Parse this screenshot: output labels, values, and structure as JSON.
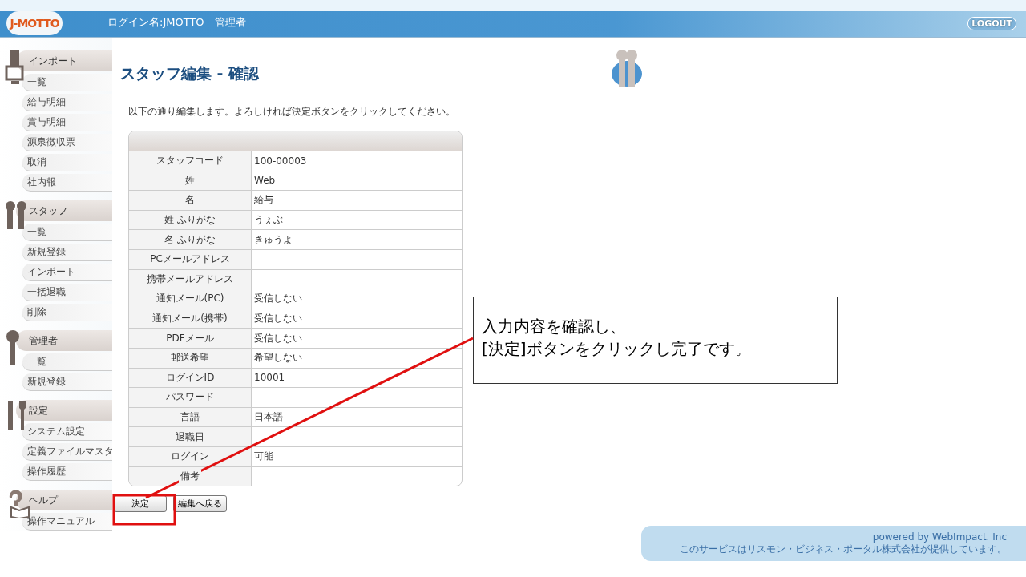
{
  "header": {
    "logo": "J-MOTTO",
    "login_label": "ログイン名:JMOTTO　管理者",
    "logout": "LOGOUT"
  },
  "sidebar": {
    "groups": [
      {
        "title": "インポート",
        "items": [
          "一覧",
          "給与明細",
          "賞与明細",
          "源泉徴収票",
          "取消",
          "社内報"
        ]
      },
      {
        "title": "スタッフ",
        "items": [
          "一覧",
          "新規登録",
          "インポート",
          "一括退職",
          "削除"
        ]
      },
      {
        "title": "管理者",
        "items": [
          "一覧",
          "新規登録"
        ]
      },
      {
        "title": "設定",
        "items": [
          "システム設定",
          "定義ファイルマスタ",
          "操作履歴"
        ]
      },
      {
        "title": "ヘルプ",
        "items": [
          "操作マニュアル"
        ]
      }
    ]
  },
  "page": {
    "title": "スタッフ編集 - 確認",
    "instruction": "以下の通り編集します。よろしければ決定ボタンをクリックしてください。"
  },
  "table": {
    "rows": [
      {
        "label": "スタッフコード",
        "value": "100-00003"
      },
      {
        "label": "姓",
        "value": "Web"
      },
      {
        "label": "名",
        "value": "給与"
      },
      {
        "label": "姓 ふりがな",
        "value": "うぇぶ"
      },
      {
        "label": "名 ふりがな",
        "value": "きゅうよ"
      },
      {
        "label": "PCメールアドレス",
        "value": ""
      },
      {
        "label": "携帯メールアドレス",
        "value": ""
      },
      {
        "label": "通知メール(PC)",
        "value": "受信しない"
      },
      {
        "label": "通知メール(携帯)",
        "value": "受信しない"
      },
      {
        "label": "PDFメール",
        "value": "受信しない"
      },
      {
        "label": "郵送希望",
        "value": "希望しない"
      },
      {
        "label": "ログインID",
        "value": "10001"
      },
      {
        "label": "パスワード",
        "value": ""
      },
      {
        "label": "言語",
        "value": "日本語"
      },
      {
        "label": "退職日",
        "value": ""
      },
      {
        "label": "ログイン",
        "value": "可能"
      },
      {
        "label": "備考",
        "value": ""
      }
    ]
  },
  "buttons": [
    "決定",
    "編集へ戻る"
  ],
  "callout": {
    "lines": [
      "入力内容を確認し、",
      "[決定]ボタンをクリックし完了です。"
    ]
  },
  "footer": {
    "powered": "powered by WebImpact. Inc",
    "notice": "このサービスはリスモン・ビジネス・ポータル株式会社が提供しています。"
  }
}
